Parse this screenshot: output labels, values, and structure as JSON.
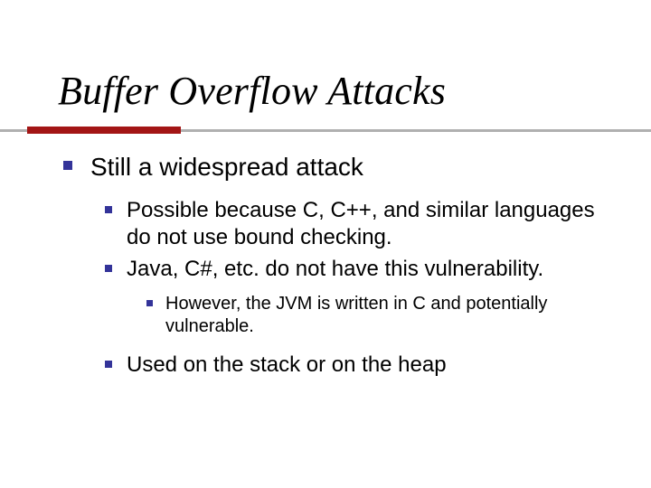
{
  "title": "Buffer Overflow Attacks",
  "colors": {
    "accent": "#333399",
    "rule": "#a31515"
  },
  "bullets": {
    "level1": [
      {
        "text": "Still a widespread attack"
      }
    ],
    "level2": [
      {
        "text": "Possible because C, C++, and similar languages do not use bound checking."
      },
      {
        "text": "Java, C#, etc. do not have this vulnerability."
      },
      {
        "text": "Used on the stack or on the heap"
      }
    ],
    "level3": [
      {
        "text": "However, the JVM is written in C and potentially vulnerable."
      }
    ]
  }
}
